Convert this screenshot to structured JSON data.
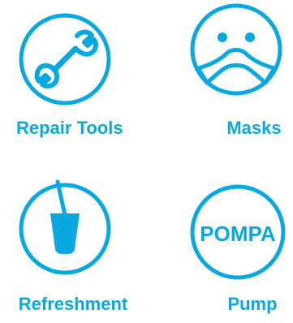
{
  "theme": {
    "accent": "#0aa8e0",
    "background": "#ffffff"
  },
  "items": [
    {
      "label": "Repair Tools",
      "icon": "wrench-icon"
    },
    {
      "label": "Masks",
      "icon": "face-mask-icon"
    },
    {
      "label": "Refreshment",
      "icon": "drink-cup-icon"
    },
    {
      "label": "Pump",
      "icon": "pump-icon",
      "icon_text": "POMPA"
    }
  ]
}
